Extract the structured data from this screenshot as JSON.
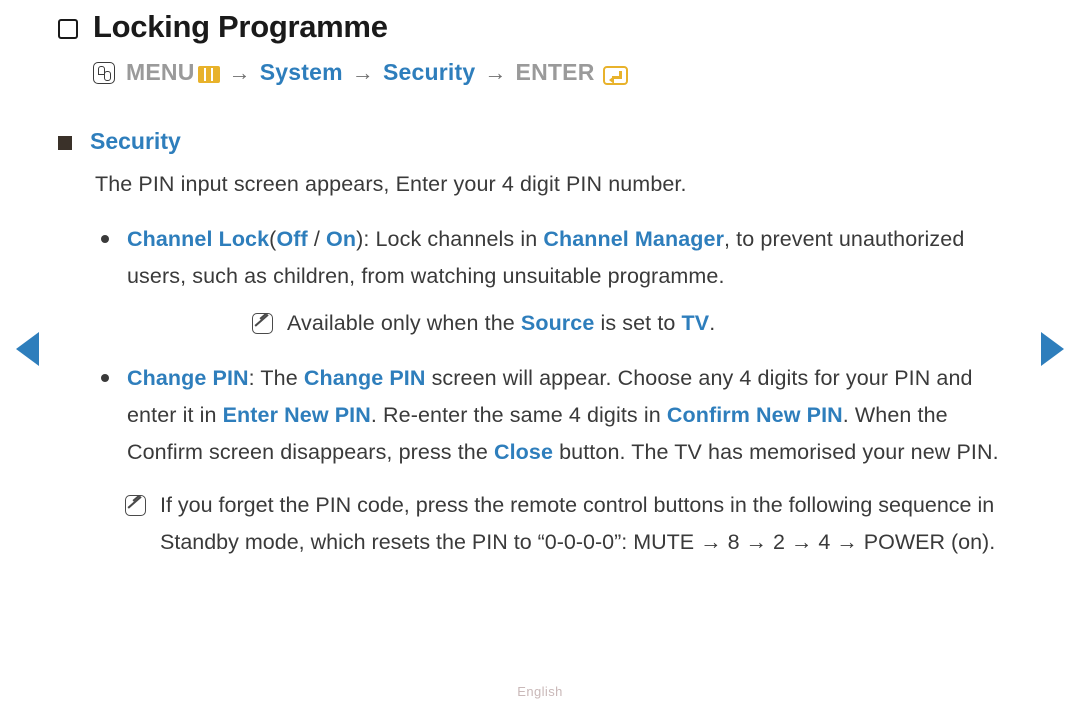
{
  "nav": {
    "prev_label": "Previous page",
    "next_label": "Next page"
  },
  "header": {
    "title": "Locking Programme"
  },
  "breadcrumb": {
    "press_icon": "remote-press-icon",
    "menu_label": "MENU",
    "menu_icon": "menu-bars-icon",
    "arrow": "→",
    "step1": "System",
    "step2": "Security",
    "enter_label": "ENTER",
    "enter_icon": "enter-key-icon"
  },
  "section": {
    "title": "Security",
    "intro": "The PIN input screen appears, Enter your 4 digit PIN number."
  },
  "bullets": [
    {
      "name": "channel-lock",
      "label": "Channel Lock",
      "paren_open": "(",
      "opt1": "Off",
      "separator": " / ",
      "opt2": "On",
      "paren_close": "):",
      "text1": " Lock channels in ",
      "link1": "Channel Manager",
      "text2": ", to prevent unauthorized users, such as children, from watching unsuitable programme.",
      "note": {
        "icon": "note-pencil-icon",
        "text1": "Available only when the ",
        "link1": "Source",
        "text2": " is set to ",
        "link2": "TV",
        "text3": "."
      }
    },
    {
      "name": "change-pin",
      "label": "Change PIN",
      "colon": ": ",
      "text1": "The ",
      "link1": "Change PIN",
      "text2": " screen will appear. Choose any 4 digits for your PIN and enter it in ",
      "link2": "Enter New PIN",
      "text3": ". Re-enter the same 4 digits in ",
      "link3": "Confirm New PIN",
      "text4": ". When the Confirm screen disappears, press the ",
      "link4": "Close",
      "text5": " button. The TV has memorised your new PIN."
    }
  ],
  "final_note": {
    "icon": "note-pencil-icon",
    "text": "If you forget the PIN code, press the remote control buttons in the following sequence in Standby mode, which resets the PIN to “0-0-0-0”: MUTE → 8 → 2 → 4 → POWER (on)."
  },
  "footer": {
    "language": "English"
  },
  "colors": {
    "accent_blue": "#2e7ebc",
    "accent_gold": "#e8b22b",
    "body_text": "#3a3a3a",
    "muted_gray": "#9a9a9a"
  }
}
